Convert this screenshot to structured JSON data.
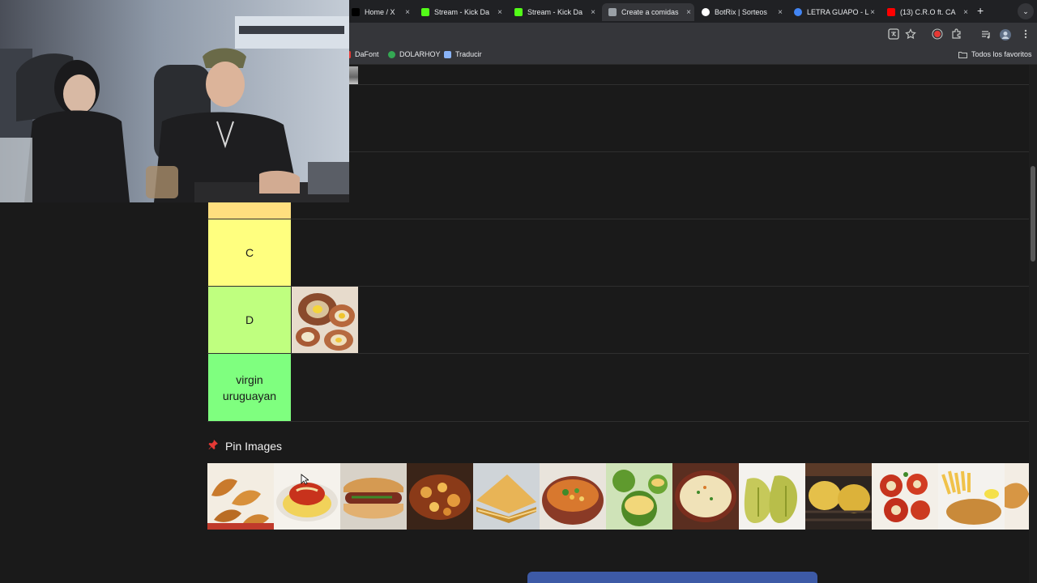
{
  "browser": {
    "tabs": [
      {
        "title": "Home / X",
        "favicon_color": "#000000",
        "active": false
      },
      {
        "title": "Stream - Kick Da",
        "favicon_color": "#53fc18",
        "active": false
      },
      {
        "title": "Stream - Kick Da",
        "favicon_color": "#53fc18",
        "active": false
      },
      {
        "title": "Create a comidas",
        "favicon_color": "#9aa0a6",
        "active": true
      },
      {
        "title": "BotRix | Sorteos",
        "favicon_color": "#ffffff",
        "active": false
      },
      {
        "title": "LETRA GUAPO - L",
        "favicon_color": "#4285f4",
        "active": false
      },
      {
        "title": "(13) C.R.O ft. CA",
        "favicon_color": "#ff0000",
        "active": false
      }
    ],
    "tab_close_glyph": "×",
    "new_tab_glyph": "+",
    "tab_menu_glyph": "⌄",
    "toolbar_icons": [
      "translate-icon",
      "star-icon",
      "record-icon",
      "extensions-icon",
      "media-icon",
      "profile-icon",
      "menu-icon"
    ],
    "bookmarks": [
      {
        "label": "DaFont",
        "color": "#e53935"
      },
      {
        "label": "DOLARHOY",
        "color": "#34a853"
      },
      {
        "label": "Traducir",
        "color": "#8ab4f8"
      }
    ],
    "all_bookmarks_label": "Todos los favoritos"
  },
  "tierlist": {
    "rows": [
      {
        "label": "",
        "color": "#1a1a1a",
        "items": [
          "small-thumb"
        ]
      },
      {
        "label": "",
        "color": "#1a1a1a",
        "items": []
      },
      {
        "label": "",
        "color": "#1a1a1a",
        "items": []
      },
      {
        "label": "C",
        "color": "#ffff7f",
        "items": []
      },
      {
        "label": "D",
        "color": "#bfff7f",
        "items": [
          "matambre"
        ]
      },
      {
        "label": "virgin uruguayan",
        "color": "#7fff7f",
        "items": []
      }
    ]
  },
  "pin_images": {
    "title": "Pin Images",
    "items": [
      "empanadas",
      "milanesa-napolitana",
      "choripan",
      "guiso",
      "tortilla",
      "locro",
      "zapallitos-rellenos",
      "sopa-crema",
      "humita",
      "provoleta",
      "ravioles",
      "milanesa-papas",
      "empanada"
    ]
  },
  "bottom_button": {
    "label": ""
  },
  "colors": {
    "accent_button": "#3d5aa6",
    "tier_c": "#ffff7f",
    "tier_d": "#bfff7f",
    "tier_virgin": "#7fff7f"
  }
}
